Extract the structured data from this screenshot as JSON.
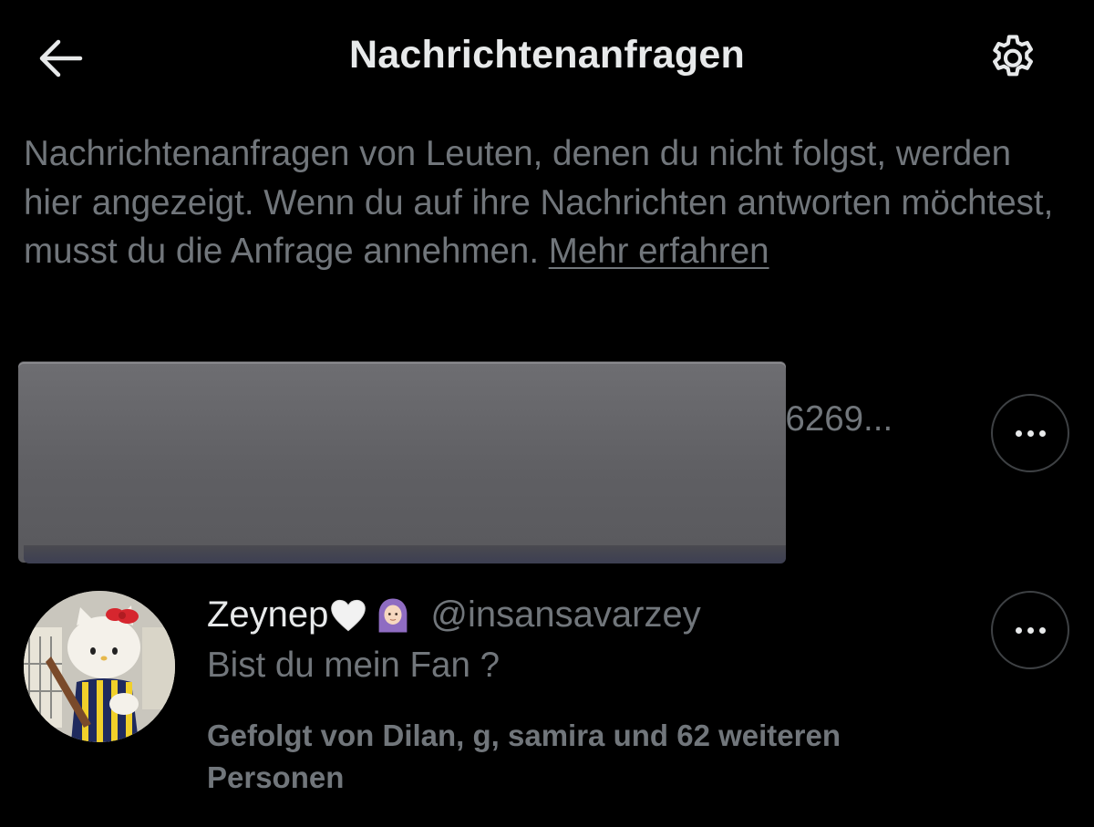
{
  "header": {
    "title": "Nachrichtenanfragen",
    "back_icon": "arrow-left-icon",
    "settings_icon": "gear-icon"
  },
  "info": {
    "text": "Nachrichtenanfragen von Leuten, denen du nicht folgst, werden hier angezeigt. Wenn du auf ihre Nachrichten antworten möchtest, musst du die Anfrage annehmen. ",
    "link": "Mehr erfahren"
  },
  "requests": [
    {
      "handle_visible": "36269...",
      "redacted": true,
      "more_icon": "more-horizontal-icon"
    },
    {
      "name": "Zeynep",
      "name_emojis": [
        "white-heart-icon",
        "woman-with-headscarf-icon"
      ],
      "handle": "@insansavarzey",
      "message": "Bist du mein Fan ?",
      "followed_by": "Gefolgt von Dilan, g, samira und 62 weiteren Personen",
      "avatar": "hello-kitty-avatar",
      "more_icon": "more-horizontal-icon"
    }
  ],
  "colors": {
    "background": "#000000",
    "text_primary": "#e7e9ea",
    "text_secondary": "#71767b",
    "border": "#3e4144",
    "redaction": "#646468"
  }
}
